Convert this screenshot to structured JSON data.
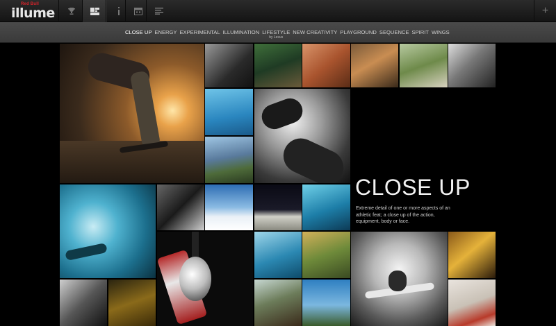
{
  "app": {
    "brand_text": "Red Bull",
    "logo_word": "illume"
  },
  "toolbar": {
    "buttons": [
      {
        "name": "trophy-button",
        "icon": "trophy-icon"
      },
      {
        "name": "mosaic-view-button",
        "icon": "mosaic-icon",
        "active": true
      },
      {
        "name": "info-button",
        "icon": "info-icon"
      },
      {
        "name": "calendar-button",
        "icon": "calendar-icon"
      },
      {
        "name": "list-view-button",
        "icon": "list-icon"
      }
    ],
    "plus_label": "+"
  },
  "categories": {
    "items": [
      {
        "label": "CLOSE UP",
        "active": true
      },
      {
        "label": "ENERGY"
      },
      {
        "label": "EXPERIMENTAL"
      },
      {
        "label": "ILLUMINATION"
      },
      {
        "label": "LIFESTYLE",
        "sub": "by Lexus"
      },
      {
        "label": "NEW CREATIVITY"
      },
      {
        "label": "PLAYGROUND"
      },
      {
        "label": "SEQUENCE"
      },
      {
        "label": "SPIRIT"
      },
      {
        "label": "WINGS"
      }
    ]
  },
  "feature": {
    "title": "CLOSE UP",
    "description": "Extreme detail of one or more aspects of an athletic feat; a close up of the action, equipment, body or face."
  },
  "colors": {
    "accent": "#d8232a",
    "bar": "#3e3e3e",
    "background": "#000000"
  }
}
